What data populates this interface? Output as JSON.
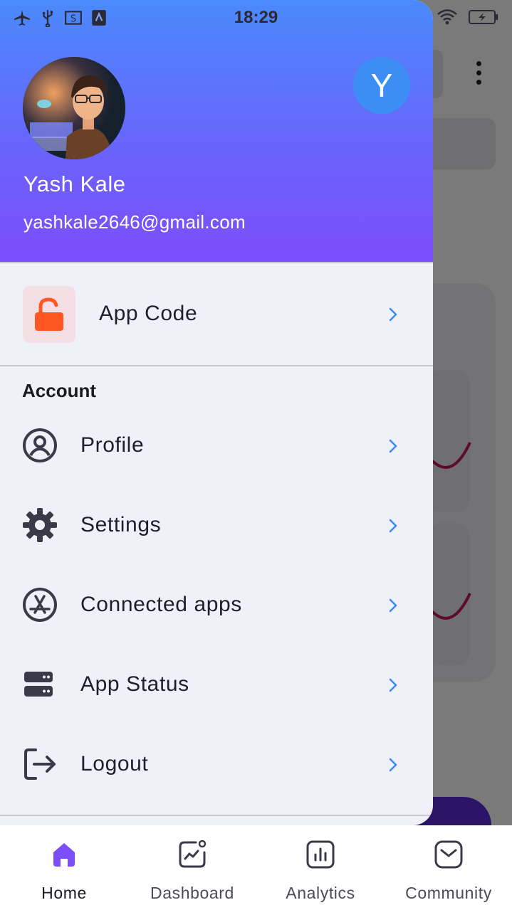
{
  "status_bar": {
    "time": "18:29",
    "icons": [
      "airplane-icon",
      "usb-icon",
      "screenshot-icon",
      "sim-icon",
      "wifi-icon",
      "battery-charging-icon"
    ]
  },
  "drawer": {
    "header": {
      "initial": "Y",
      "name": "Yash Kale",
      "email": "yashkale2646@gmail.com",
      "gradient": [
        "#4a8afc",
        "#7c4dfb"
      ]
    },
    "app_code": {
      "label": "App Code",
      "icon": "unlocked-padlock-icon",
      "icon_color": "#ff5722"
    },
    "section_title": "Account",
    "items": [
      {
        "label": "Profile",
        "icon": "user-circle-icon"
      },
      {
        "label": "Settings",
        "icon": "gear-icon"
      },
      {
        "label": "Connected apps",
        "icon": "app-store-icon"
      },
      {
        "label": "App Status",
        "icon": "server-icon"
      },
      {
        "label": "Logout",
        "icon": "logout-icon"
      }
    ],
    "chevron_color": "#3c8ef5"
  },
  "bottom_nav": {
    "active_color": "#7c4dfb",
    "items": [
      {
        "label": "Home",
        "icon": "home-icon",
        "active": true
      },
      {
        "label": "Dashboard",
        "icon": "chart-line-icon",
        "active": false
      },
      {
        "label": "Analytics",
        "icon": "bar-chart-icon",
        "active": false
      },
      {
        "label": "Community",
        "icon": "mail-icon",
        "active": false
      }
    ]
  }
}
